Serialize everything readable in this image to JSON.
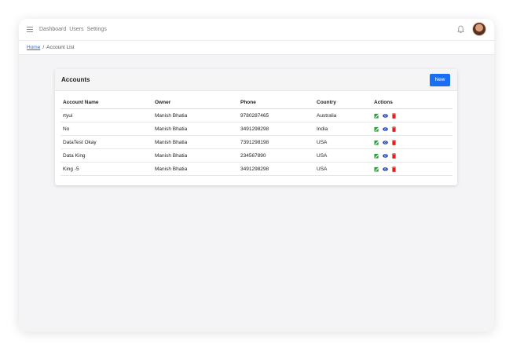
{
  "nav": {
    "links": [
      "Dashboard",
      "Users",
      "Settings"
    ]
  },
  "breadcrumb": {
    "home": "Home",
    "separator": "/",
    "current": "Account List"
  },
  "card": {
    "title": "Accounts",
    "new_button": "New"
  },
  "table": {
    "headers": [
      "Account Name",
      "Owner",
      "Phone",
      "Country",
      "Actions"
    ],
    "rows": [
      {
        "name": "rtyui",
        "owner": "Manish Bhatia",
        "phone": "9780287465",
        "country": "Australia"
      },
      {
        "name": "No",
        "owner": "Manish Bhatia",
        "phone": "3491298298",
        "country": "India"
      },
      {
        "name": "DataTest Okay",
        "owner": "Manish Bhatia",
        "phone": "7391298198",
        "country": "USA"
      },
      {
        "name": "Data King",
        "owner": "Manish Bhatia",
        "phone": "234567890",
        "country": "USA"
      },
      {
        "name": "King -5",
        "owner": "Manish Bhatia",
        "phone": "3491298298",
        "country": "USA"
      }
    ]
  },
  "icons": {
    "menu": "hamburger-icon",
    "notifications": "bell-icon",
    "edit": "edit-icon",
    "view": "eye-icon",
    "delete": "trash-icon"
  },
  "colors": {
    "primary": "#1a6ef5",
    "edit": "#2e9e3a",
    "view": "#1f3fa8",
    "delete": "#e01f1f",
    "link": "#2a6ad8"
  }
}
